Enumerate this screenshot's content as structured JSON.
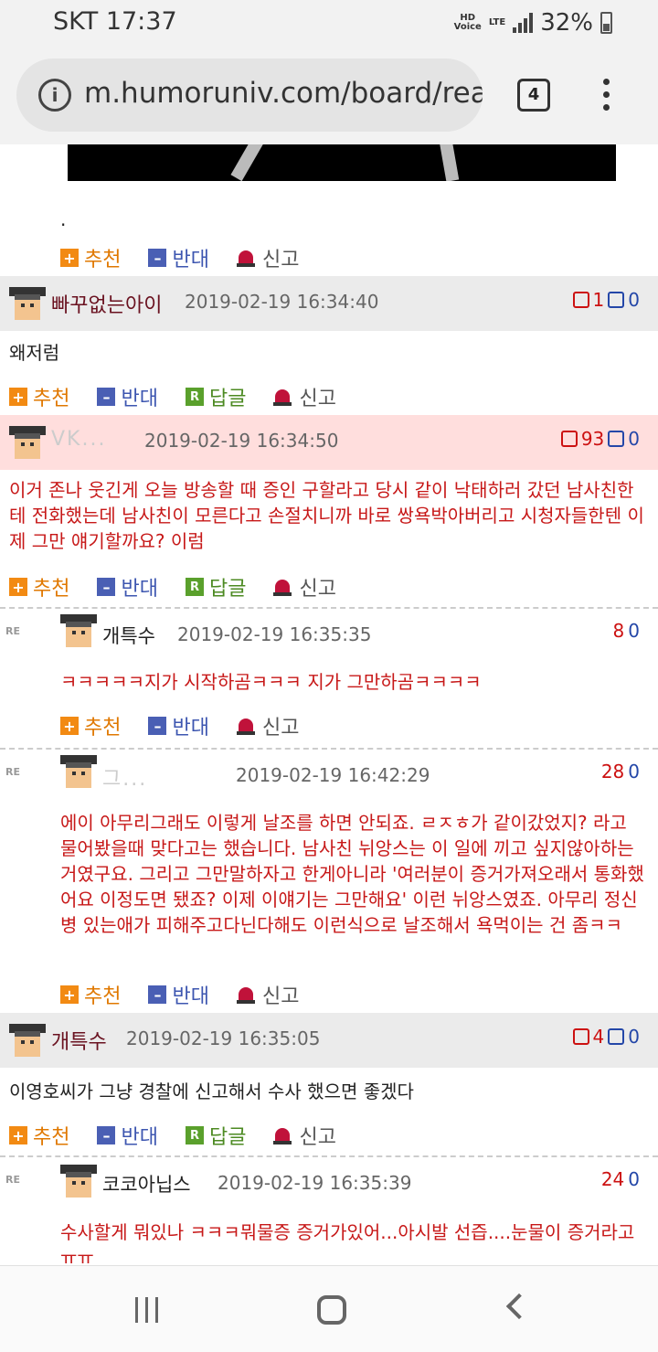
{
  "status_bar": {
    "carrier_time": "SKT 17:37",
    "hd_label": "HD\nVoice",
    "lte_label": "LTE",
    "battery": "32%"
  },
  "browser": {
    "url": "m.humoruniv.com/board/read",
    "tab_count": "4"
  },
  "labels": {
    "recommend": "추천",
    "oppose": "반대",
    "reply": "답글",
    "report": "신고",
    "re": "RE"
  },
  "top_dot": ".",
  "comments": [
    {
      "nick": "빠꾸없는아이",
      "date": "2019-02-19 16:34:40",
      "up": "1",
      "down": "0",
      "text": "왜저럼"
    },
    {
      "nick": "VK...",
      "date": "2019-02-19 16:34:50",
      "up": "93",
      "down": "0",
      "text": "이거 존나 웃긴게 오늘 방송할 때 증인 구할라고 당시 같이 낙태하러 갔던 남사친한테 전화했는데 남사친이 모른다고 손절치니까 바로 쌍욕박아버리고 시청자들한텐 이제 그만 얘기할까요? 이럼"
    },
    {
      "nick": "개특수",
      "date": "2019-02-19 16:35:35",
      "up": "8",
      "down": "0",
      "text": "ㅋㅋㅋㅋㅋ지가 시작하곰ㅋㅋㅋ 지가 그만하곰ㅋㅋㅋㅋ"
    },
    {
      "nick": "그...",
      "date": "2019-02-19 16:42:29",
      "up": "28",
      "down": "0",
      "text": "에이 아무리그래도 이렇게 날조를 하면 안되죠. ㄹㅈㅎ가 같이갔었지? 라고 물어봤을때 맞다고는 했습니다. 남사친 뉘앙스는 이 일에 끼고 싶지않아하는거였구요. 그리고 그만말하자고 한게아니라 '여러분이 증거가져오래서 통화했어요 이정도면 됐죠? 이제 이얘기는 그만해요' 이런 뉘앙스였죠. 아무리 정신병 있는애가 피해주고다닌다해도 이런식으로 날조해서 욕먹이는 건 좀ㅋㅋ"
    },
    {
      "nick": "개특수",
      "date": "2019-02-19 16:35:05",
      "up": "4",
      "down": "0",
      "text": "이영호씨가 그냥 경찰에 신고해서 수사 했으면 좋겠다"
    },
    {
      "nick": "코코아닙스",
      "date": "2019-02-19 16:35:39",
      "up": "24",
      "down": "0",
      "text": "수사할게 뭐있나 ㅋㅋㅋ뭐물증 증거가있어...아시발 선즙....눈물이 증거라고 ㅠㅠ"
    }
  ]
}
